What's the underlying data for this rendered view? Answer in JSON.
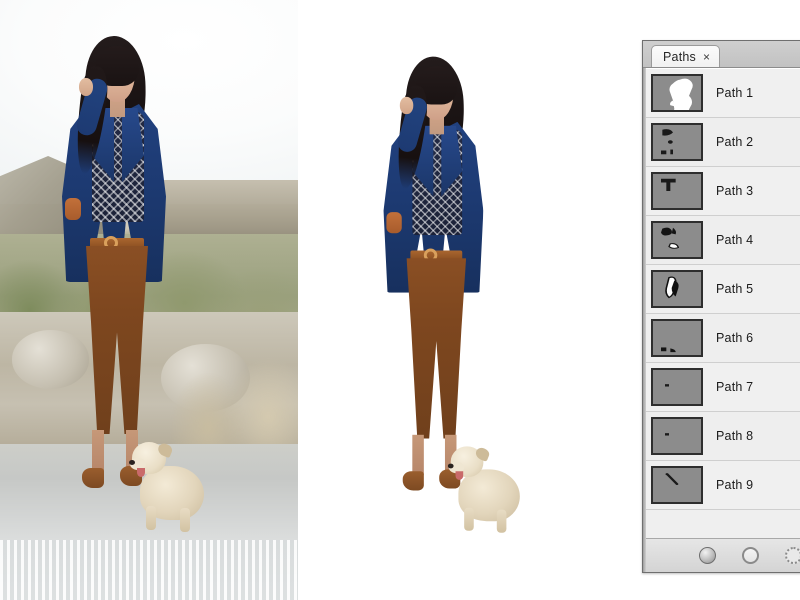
{
  "app": {
    "context": "photoshop-clipping-path-demo"
  },
  "images": {
    "original": {
      "name": "original-photo",
      "alt_description": "Woman in navy blazer and brown trousers standing outdoors beside a small scruffy dog, stone wall and coastal scrub in the background",
      "background": "outdoor-scene"
    },
    "cutout": {
      "name": "cutout-photo",
      "alt_description": "Same woman and dog isolated on a plain white background after clipping path extraction",
      "background": "white"
    }
  },
  "panel": {
    "tab": {
      "label": "Paths",
      "close_glyph": "×"
    },
    "rows": [
      {
        "label": "Path 1",
        "thumb": "figure-full-silhouette"
      },
      {
        "label": "Path 2",
        "thumb": "shoe-and-specks"
      },
      {
        "label": "Path 3",
        "thumb": "small-t-shape"
      },
      {
        "label": "Path 4",
        "thumb": "two-shoes"
      },
      {
        "label": "Path 5",
        "thumb": "legs-pair"
      },
      {
        "label": "Path 6",
        "thumb": "two-dots-lower-left"
      },
      {
        "label": "Path 7",
        "thumb": "single-small-dot"
      },
      {
        "label": "Path 8",
        "thumb": "single-small-dot"
      },
      {
        "label": "Path 9",
        "thumb": "thin-diagonal-stroke"
      }
    ],
    "footer_buttons": [
      {
        "name": "fill-path-with-foreground-color",
        "style": "filled"
      },
      {
        "name": "stroke-path-with-brush",
        "style": "hollow"
      },
      {
        "name": "load-path-as-selection",
        "style": "dashed"
      }
    ]
  },
  "colors": {
    "blazer": "#1d3a72",
    "trousers": "#7e471f",
    "panel_bg": "#d6d6d6",
    "list_bg": "#efefef",
    "thumb_bg": "#8c8c8c",
    "text": "#1b1b1b"
  }
}
